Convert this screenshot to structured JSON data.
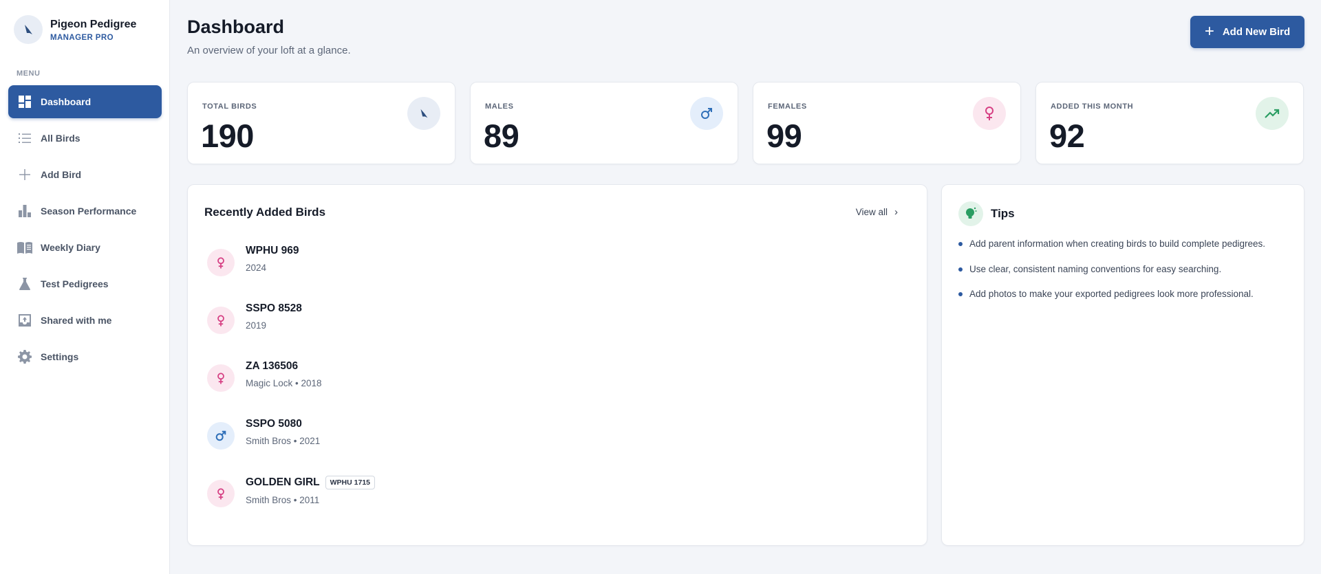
{
  "brand": {
    "name": "Pigeon Pedigree",
    "subtitle": "MANAGER PRO",
    "logo_icon": "pigeon-icon"
  },
  "menu_label": "MENU",
  "nav": [
    {
      "label": "Dashboard",
      "icon": "dashboard-icon",
      "active": true
    },
    {
      "label": "All Birds",
      "icon": "list-icon"
    },
    {
      "label": "Add Bird",
      "icon": "plus-icon"
    },
    {
      "label": "Season Performance",
      "icon": "bar-chart-icon"
    },
    {
      "label": "Weekly Diary",
      "icon": "book-icon"
    },
    {
      "label": "Test Pedigrees",
      "icon": "flask-icon"
    },
    {
      "label": "Shared with me",
      "icon": "inbox-icon"
    },
    {
      "label": "Settings",
      "icon": "gear-icon"
    }
  ],
  "header": {
    "title": "Dashboard",
    "subtitle": "An overview of your loft at a glance.",
    "add_button": "Add New Bird"
  },
  "stats": [
    {
      "label": "TOTAL BIRDS",
      "value": "190",
      "icon": "pigeon-icon",
      "color": "#e8edf5"
    },
    {
      "label": "MALES",
      "value": "89",
      "icon": "male-icon",
      "color": "#e4eefb"
    },
    {
      "label": "FEMALES",
      "value": "99",
      "icon": "female-icon",
      "color": "#fbe7ef"
    },
    {
      "label": "ADDED THIS MONTH",
      "value": "92",
      "icon": "trending-up-icon",
      "color": "#e2f3e9"
    }
  ],
  "recent": {
    "title": "Recently Added Birds",
    "view_all": "View all",
    "birds": [
      {
        "name": "WPHU 969",
        "meta": "2024",
        "sex": "female",
        "tag": ""
      },
      {
        "name": "SSPO 8528",
        "meta": "2019",
        "sex": "female",
        "tag": ""
      },
      {
        "name": "ZA 136506",
        "meta": "Magic Lock • 2018",
        "sex": "female",
        "tag": ""
      },
      {
        "name": "SSPO 5080",
        "meta": "Smith Bros • 2021",
        "sex": "male",
        "tag": ""
      },
      {
        "name": "GOLDEN GIRL",
        "meta": "Smith Bros • 2011",
        "sex": "female",
        "tag": "WPHU 1715"
      }
    ]
  },
  "tips": {
    "title": "Tips",
    "items": [
      "Add parent information when creating birds to build complete pedigrees.",
      "Use clear, consistent naming conventions for easy searching.",
      "Add photos to make your exported pedigrees look more professional."
    ]
  },
  "colors": {
    "primary": "#2d5aa0",
    "female": "#d63f83",
    "male": "#2f6fb8",
    "growth": "#2a9d62"
  }
}
